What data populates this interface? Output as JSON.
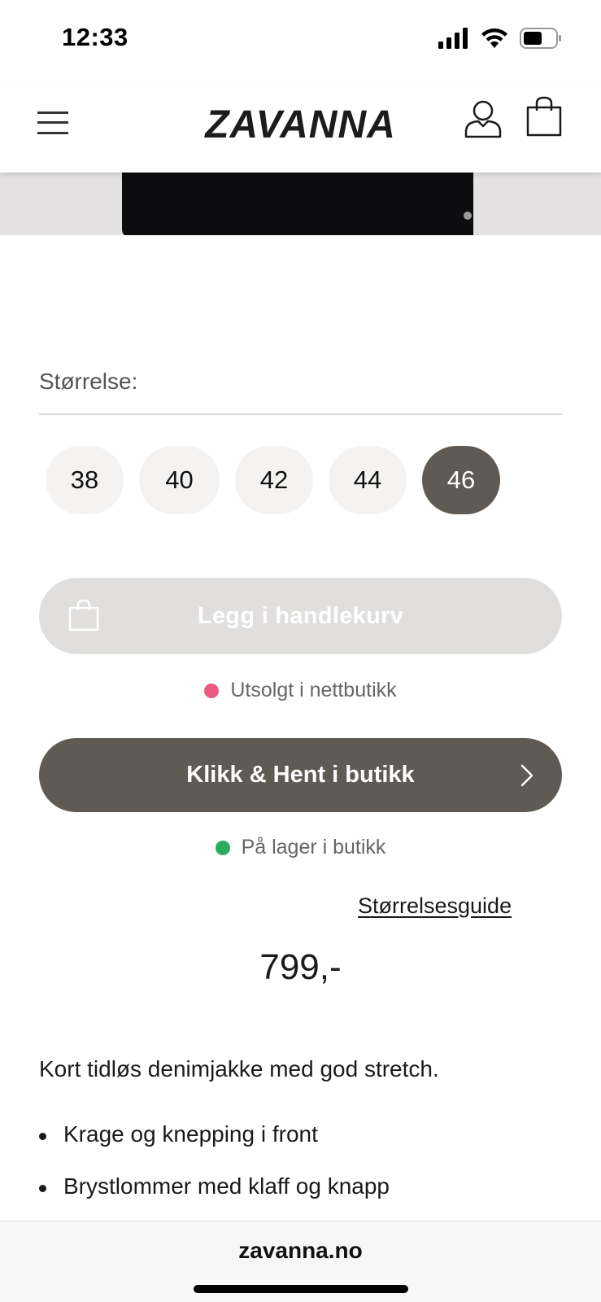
{
  "status_bar": {
    "time": "12:33"
  },
  "header": {
    "logo": "ZAVANNA",
    "icons": [
      "menu-icon",
      "account-icon",
      "shopping-bag-icon"
    ]
  },
  "size_selector": {
    "label": "Størrelse:",
    "sizes": [
      {
        "label": "38",
        "selected": false
      },
      {
        "label": "40",
        "selected": false
      },
      {
        "label": "42",
        "selected": false
      },
      {
        "label": "44",
        "selected": false
      },
      {
        "label": "46",
        "selected": true
      }
    ]
  },
  "add_to_cart": {
    "label": "Legg i handlekurv",
    "enabled": false
  },
  "online_stock": {
    "text": "Utsolgt i nettbutikk",
    "status_color": "#e85a7f"
  },
  "click_collect": {
    "label": "Klikk & Hent i butikk"
  },
  "store_stock": {
    "text": "På lager i butikk",
    "status_color": "#2bab5c"
  },
  "size_guide": {
    "label": "Størrelsesguide"
  },
  "product": {
    "price": "799,-",
    "description": "Kort tidløs denimjakke med god stretch.",
    "features": [
      "Krage og knepping i front",
      "Brystlommer med klaff og knapp"
    ]
  },
  "browser": {
    "url": "zavanna.no"
  },
  "colors": {
    "primary_button": "#5f5a54",
    "disabled_button": "#e0dfde",
    "size_chip": "#f4f3f1"
  }
}
